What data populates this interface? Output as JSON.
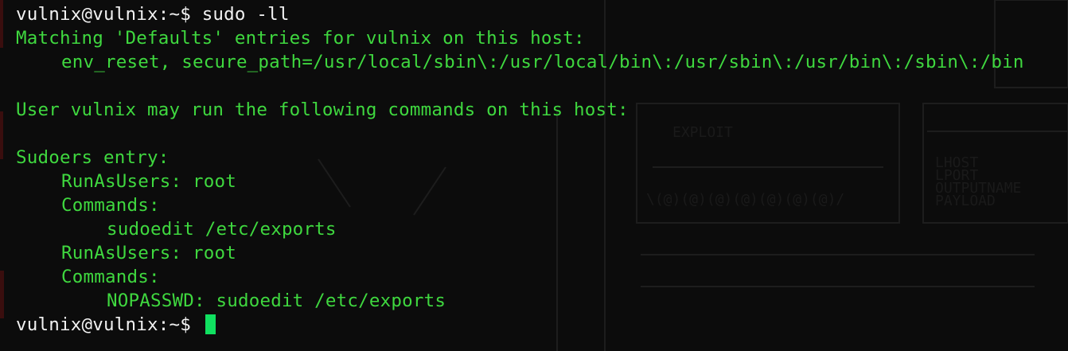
{
  "terminal": {
    "prompt": "vulnix@vulnix:~$ ",
    "command": "sudo -ll",
    "output": {
      "matching_header": "Matching 'Defaults' entries for vulnix on this host:",
      "defaults_entry": "env_reset, secure_path=/usr/local/sbin\\:/usr/local/bin\\:/usr/sbin\\:/usr/bin\\:/sbin\\:/bin",
      "may_run_header": "User vulnix may run the following commands on this host:",
      "sudoers_header": "Sudoers entry:",
      "entry1_runas": "RunAsUsers: root",
      "entry1_commands_label": "Commands:",
      "entry1_command": "sudoedit /etc/exports",
      "entry2_runas": "RunAsUsers: root",
      "entry2_commands_label": "Commands:",
      "entry2_command": "NOPASSWD: sudoedit /etc/exports"
    },
    "final_prompt": "vulnix@vulnix:~$ "
  },
  "colors": {
    "background": "#0c0c0c",
    "output_text": "#3fd83f",
    "prompt_text": "#f2f2f2",
    "cursor": "#10e060"
  }
}
